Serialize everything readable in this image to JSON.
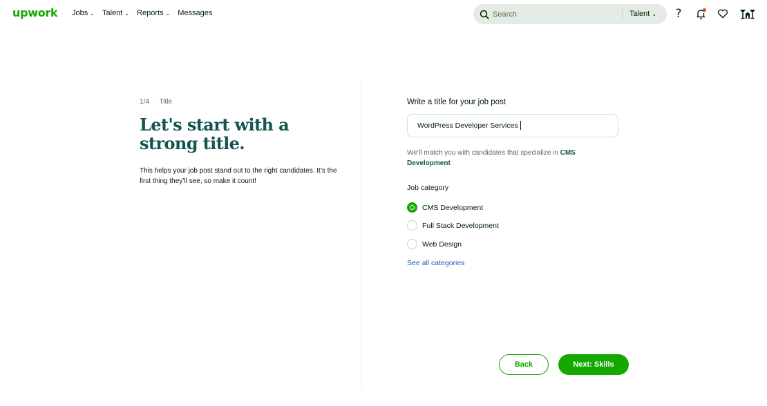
{
  "header": {
    "logo": "upwork",
    "nav": [
      {
        "label": "Jobs",
        "has_dropdown": true
      },
      {
        "label": "Talent",
        "has_dropdown": true
      },
      {
        "label": "Reports",
        "has_dropdown": true
      },
      {
        "label": "Messages",
        "has_dropdown": false
      }
    ],
    "search": {
      "placeholder": "Search",
      "scope": "Talent"
    },
    "icons": [
      "help-icon",
      "notification-bell-icon",
      "heart-icon",
      "organization-icon"
    ],
    "notification_dot_color": "#f5431b"
  },
  "left": {
    "step_number": "1/4",
    "step_name": "Title",
    "headline": "Let's start with a strong title.",
    "description": "This helps your job post stand out to the right candidates. It’s the first thing they’ll see, so make it count!"
  },
  "right": {
    "title_label": "Write a title for your job post",
    "title_value": "WordPress Developer Services",
    "hint_prefix": "We’ll match you with candidates that specialize in ",
    "hint_category": "CMS Development",
    "category_label": "Job category",
    "categories": [
      {
        "label": "CMS Development",
        "selected": true
      },
      {
        "label": "Full Stack Development",
        "selected": false
      },
      {
        "label": "Web Design",
        "selected": false
      }
    ],
    "see_all": "See all categories"
  },
  "footer": {
    "back_label": "Back",
    "next_label": "Next: Skills"
  },
  "colors": {
    "brand_green": "#14a800",
    "headline_teal": "#13544e",
    "link_blue": "#1f57c3"
  }
}
